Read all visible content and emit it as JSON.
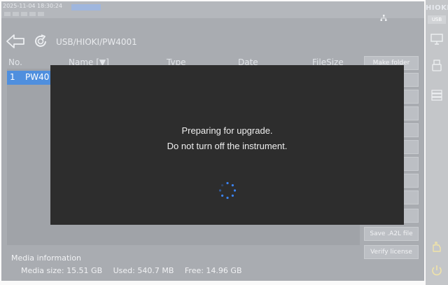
{
  "status_bar": {
    "datetime": "2025-11-04  18:30:24",
    "mode_badge": ""
  },
  "navigation": {
    "path": "USB/HIOKI/PW4001",
    "back_icon": "arrow-left-icon",
    "refresh_icon": "refresh-icon"
  },
  "file_table": {
    "columns": [
      "No.",
      "Name [▼]",
      "Type",
      "Date",
      "FileSize"
    ],
    "rows": [
      {
        "no": "1",
        "name": "PW40"
      }
    ]
  },
  "side_buttons": {
    "make_folder": "Make folder",
    "save_a2l": "Save .A2L file",
    "verify_license": "Verify license"
  },
  "media": {
    "title": "Media information",
    "size": "Media size: 15.51 GB",
    "used": "Used: 540.7 MB",
    "free": "Free: 14.96 GB"
  },
  "right_rail": {
    "logo": "HIOKI",
    "usb": "USB"
  },
  "dialog": {
    "line1": "Preparing for upgrade.",
    "line2": "Do not turn off the instrument."
  },
  "colors": {
    "selected_row": "#4f8fde",
    "dialog_bg": "#2d2d2d",
    "spinner": "#3b82f0"
  }
}
